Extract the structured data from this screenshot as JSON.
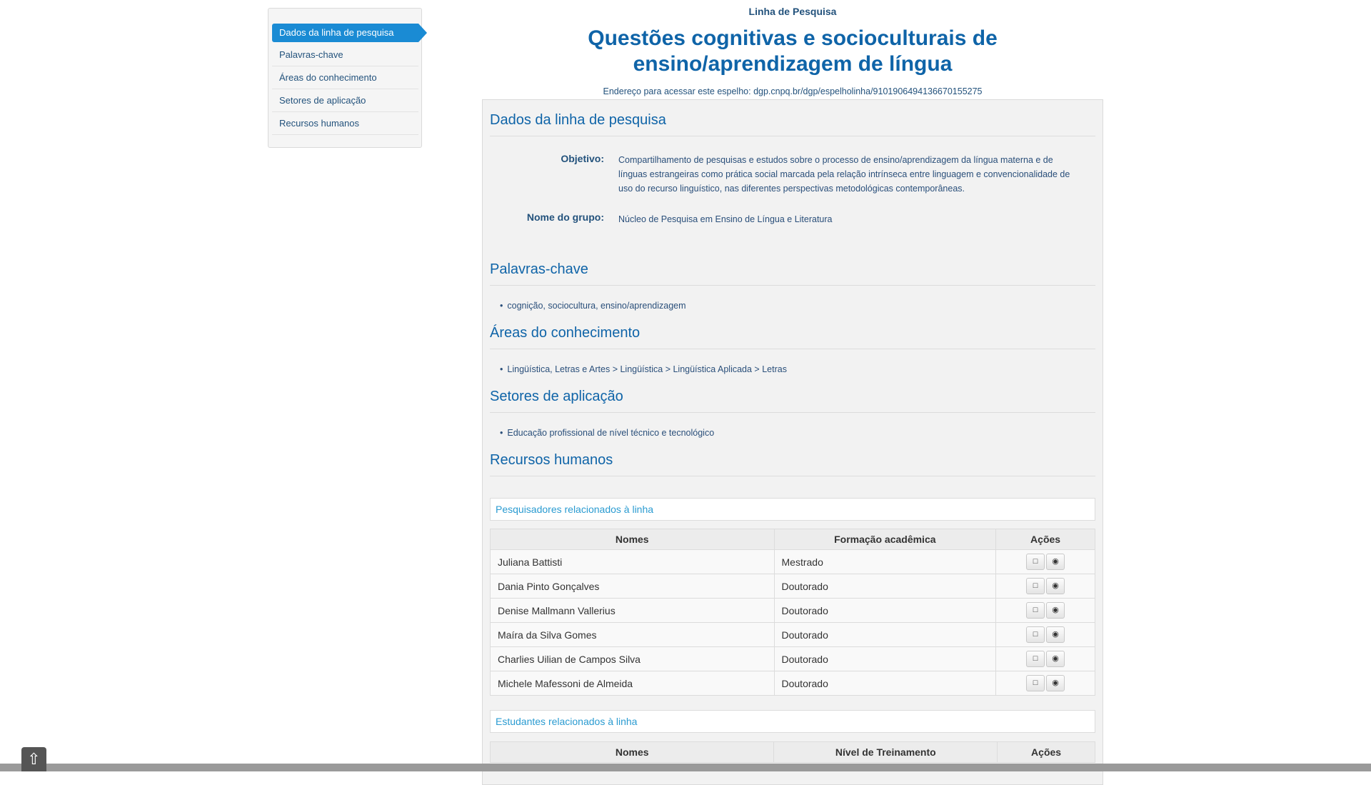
{
  "sidebar": {
    "items": [
      {
        "label": "Dados da linha de pesquisa"
      },
      {
        "label": "Palavras-chave"
      },
      {
        "label": "Áreas do conhecimento"
      },
      {
        "label": "Setores de aplicação"
      },
      {
        "label": "Recursos humanos"
      }
    ]
  },
  "header": {
    "kicker": "Linha de Pesquisa",
    "title": "Questões cognitivas e socioculturais de ensino/aprendizagem de língua",
    "address_label": "Endereço para acessar este espelho:",
    "address_url": "dgp.cnpq.br/dgp/espelholinha/9101906494136670155275"
  },
  "dados": {
    "title": "Dados da linha de pesquisa",
    "objetivo_label": "Objetivo:",
    "objetivo_value": "Compartilhamento de pesquisas e estudos sobre o processo de ensino/aprendizagem da língua materna e de línguas estrangeiras como prática social marcada pela relação intrínseca entre linguagem e convencionalidade de uso do recurso linguístico, nas diferentes perspectivas metodológicas contemporâneas.",
    "grupo_label": "Nome do grupo:",
    "grupo_value": "Núcleo de Pesquisa em Ensino de Língua e Literatura"
  },
  "palavras": {
    "title": "Palavras-chave",
    "items": [
      "cognição, sociocultura, ensino/aprendizagem"
    ]
  },
  "areas": {
    "title": "Áreas do conhecimento",
    "items": [
      "Lingüística, Letras e Artes > Lingüística > Lingüística Aplicada > Letras"
    ]
  },
  "setores": {
    "title": "Setores de aplicação",
    "items": [
      "Educação profissional de nível técnico e tecnológico"
    ]
  },
  "recursos": {
    "title": "Recursos humanos",
    "pesquisadores_label": "Pesquisadores relacionados à linha",
    "pesquisadores_headers": [
      "Nomes",
      "Formação acadêmica",
      "Ações"
    ],
    "pesquisadores": [
      {
        "nome": "Juliana Battisti",
        "formacao": "Mestrado"
      },
      {
        "nome": "Dania Pinto Gonçalves",
        "formacao": "Doutorado"
      },
      {
        "nome": "Denise Mallmann Vallerius",
        "formacao": "Doutorado"
      },
      {
        "nome": "Maíra da Silva Gomes",
        "formacao": "Doutorado"
      },
      {
        "nome": "Charlies Uilian de Campos Silva",
        "formacao": "Doutorado"
      },
      {
        "nome": "Michele Mafessoni de Almeida",
        "formacao": "Doutorado"
      }
    ],
    "estudantes_label": "Estudantes relacionados à linha",
    "estudantes_headers": [
      "Nomes",
      "Nível de Treinamento",
      "Ações"
    ]
  },
  "icons": {
    "curriculum": "document-icon",
    "view": "eye-icon",
    "scroll_top": "arrow-up-icon"
  }
}
